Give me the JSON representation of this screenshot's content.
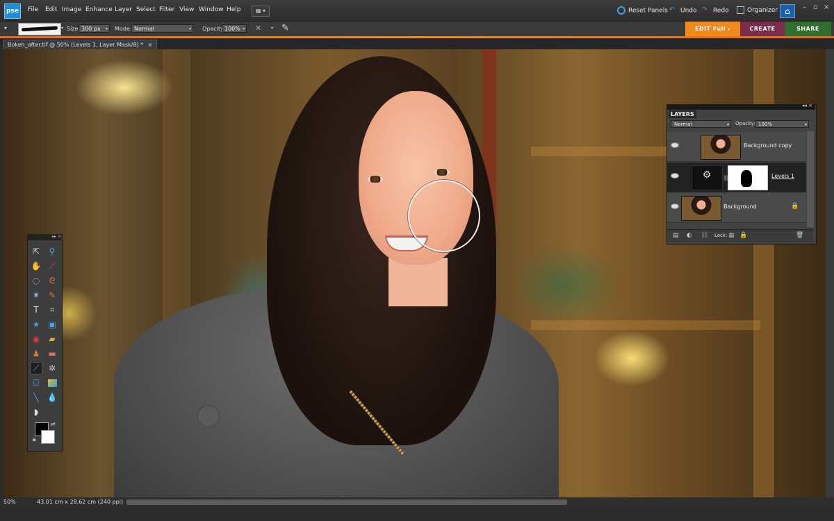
{
  "app": {
    "logo": "pse"
  },
  "menu": [
    "File",
    "Edit",
    "Image",
    "Enhance",
    "Layer",
    "Select",
    "Filter",
    "View",
    "Window",
    "Help"
  ],
  "topbar": {
    "reset_panels": "Reset Panels",
    "undo": "Undo",
    "redo": "Redo",
    "organizer": "Organizer"
  },
  "options": {
    "size_label": "Size:",
    "size_value": "300 px",
    "mode_label": "Mode:",
    "mode_value": "Normal",
    "opacity_label": "Opacity:",
    "opacity_value": "100%"
  },
  "mode_buttons": {
    "edit": "EDIT Full",
    "create": "CREATE",
    "share": "SHARE"
  },
  "colors": {
    "edit": "#f08a1c",
    "create": "#7a2c4a",
    "share": "#2f6e2f",
    "accent_strip": "#e96b10"
  },
  "document": {
    "tab_title": "Bokeh_after.tif @ 50% (Levels 1, Layer Mask/8) *",
    "close": "×"
  },
  "status": {
    "zoom": "50%",
    "size": "43.01 cm x 28.62 cm (240 ppi)"
  },
  "layers_panel": {
    "title": "LAYERS",
    "blend_mode": "Normal",
    "opacity_label": "Opacity:",
    "opacity_value": "100%",
    "lock_label": "Lock:",
    "layers": [
      {
        "name": "Background copy",
        "selected": false
      },
      {
        "name": "Levels 1",
        "selected": true
      },
      {
        "name": "Background",
        "selected": false,
        "locked": true
      }
    ]
  },
  "tools": [
    "move-icon",
    "zoom-icon",
    "hand-icon",
    "eyedropper-icon",
    "marquee-icon",
    "lasso-icon",
    "magic-wand-icon",
    "quick-selection-icon",
    "type-icon",
    "crop-icon",
    "custom-shape-icon",
    "recompose-icon",
    "red-eye-icon",
    "spot-healing-icon",
    "clone-stamp-icon",
    "eraser-icon",
    "brush-icon",
    "smart-brush-icon",
    "paint-bucket-icon",
    "gradient-icon",
    "line-icon",
    "blur-icon",
    "sponge-icon"
  ]
}
